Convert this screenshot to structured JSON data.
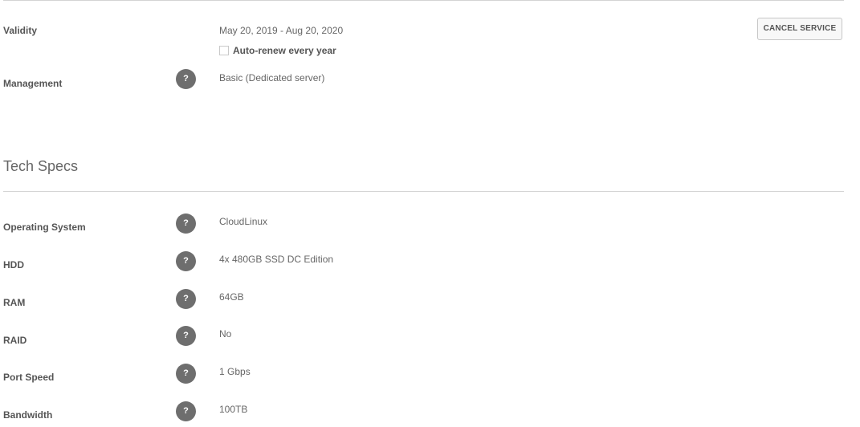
{
  "service": {
    "validity": {
      "label": "Validity",
      "value": "May 20, 2019 - Aug 20, 2020",
      "auto_renew_label": "Auto-renew every year",
      "auto_renew_checked": false
    },
    "management": {
      "label": "Management",
      "help": "?",
      "value": "Basic (Dedicated server)"
    },
    "cancel_button_label": "CANCEL SERVICE"
  },
  "tech_specs": {
    "title": "Tech Specs",
    "rows": [
      {
        "label": "Operating System",
        "help": "?",
        "value": "CloudLinux"
      },
      {
        "label": "HDD",
        "help": "?",
        "value": "4x 480GB SSD DC Edition"
      },
      {
        "label": "RAM",
        "help": "?",
        "value": "64GB"
      },
      {
        "label": "RAID",
        "help": "?",
        "value": "No"
      },
      {
        "label": "Port Speed",
        "help": "?",
        "value": "1 Gbps"
      },
      {
        "label": "Bandwidth",
        "help": "?",
        "value": "100TB"
      }
    ]
  },
  "colors": {
    "help_icon_bg": "#6e6e6e",
    "divider": "#d4d4d4",
    "text": "#555555"
  }
}
